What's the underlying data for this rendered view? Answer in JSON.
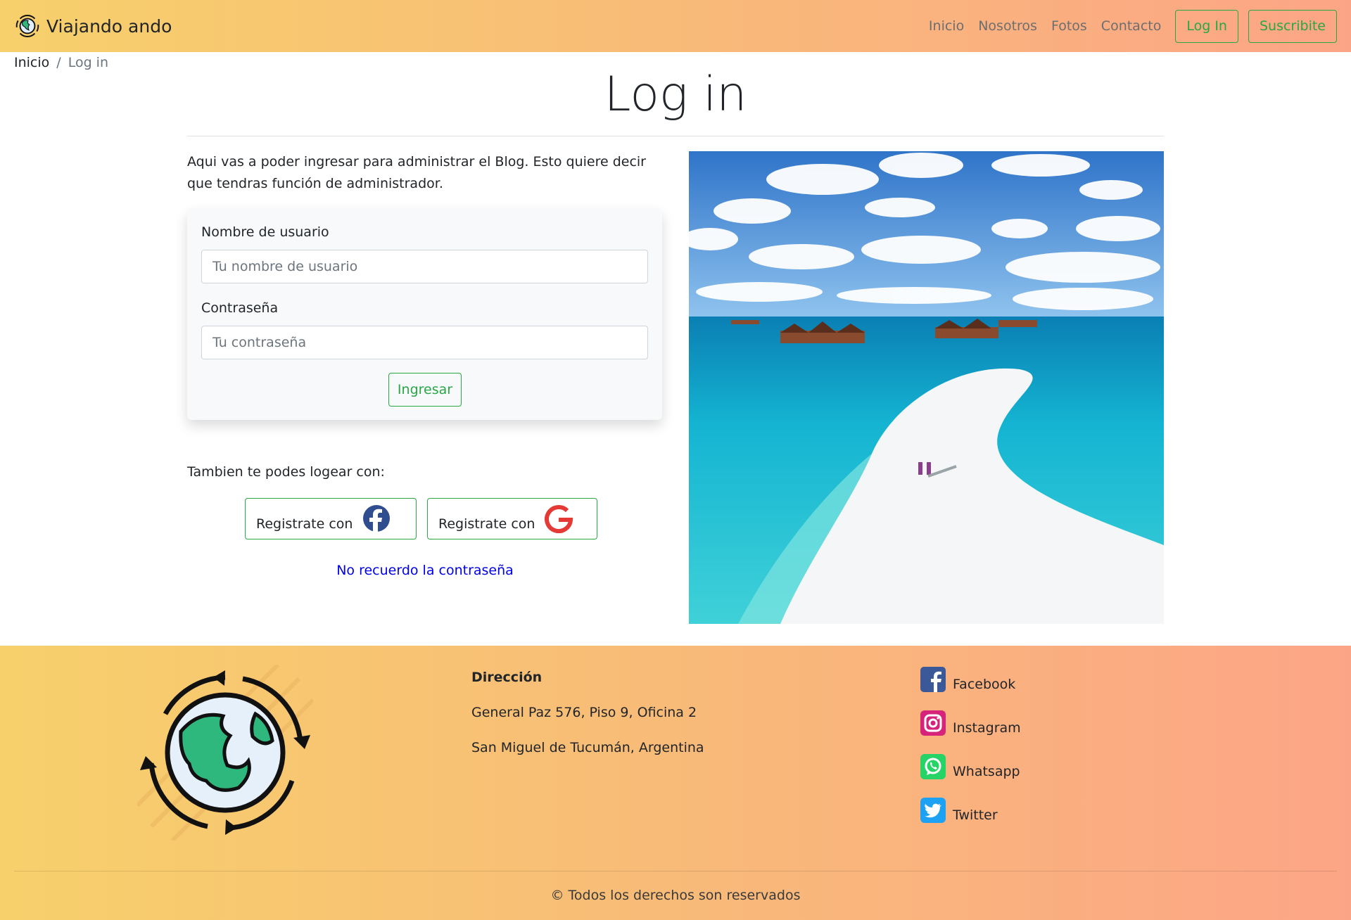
{
  "navbar": {
    "brand": "Viajando ando",
    "links": [
      "Inicio",
      "Nosotros",
      "Fotos",
      "Contacto"
    ],
    "login_label": "Log In",
    "subscribe_label": "Suscribite"
  },
  "breadcrumb": {
    "home": "Inicio",
    "separator": "/",
    "current": "Log in"
  },
  "main": {
    "title": "Log in",
    "intro": "Aqui vas a poder ingresar para administrar el Blog. Esto quiere decir que tendras función de administrador.",
    "form": {
      "username_label": "Nombre de usuario",
      "username_placeholder": "Tu nombre de usuario",
      "password_label": "Contraseña",
      "password_placeholder": "Tu contraseña",
      "submit_label": "Ingresar"
    },
    "social": {
      "prompt": "Tambien te podes logear con:",
      "facebook_label": "Registrate con",
      "google_label": "Registrate con"
    },
    "forgot_link": "No recuerdo la contraseña"
  },
  "footer": {
    "address_title": "Dirección",
    "address_line1": "General Paz 576, Piso 9, Oficina 2",
    "address_line2": "San Miguel de Tucumán, Argentina",
    "social": [
      "Facebook",
      "Instagram",
      "Whatsapp",
      "Twitter"
    ],
    "copyright": "© Todos los derechos son reservados"
  },
  "colors": {
    "gradient_start": "#f7d06b",
    "gradient_end": "#fca586",
    "accent_green": "#28a745",
    "link_blue": "#0000ee"
  }
}
